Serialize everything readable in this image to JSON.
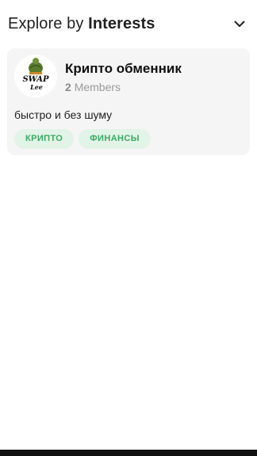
{
  "header": {
    "title_prefix": "Explore by",
    "title_bold": "Interests",
    "toggle_icon": "chevron-down-icon"
  },
  "community": {
    "name": "Крипто обменник",
    "members_count": "2",
    "members_label": "Members",
    "description": "быстро и без шуму",
    "logo": {
      "line1": "SWAP",
      "line2": "Lee"
    },
    "tags": [
      "КРИПТО",
      "ФИНАНСЫ"
    ]
  },
  "colors": {
    "card_bg": "#f5f5f5",
    "tag_bg": "#e2f3e7",
    "tag_text": "#3aaa62"
  }
}
